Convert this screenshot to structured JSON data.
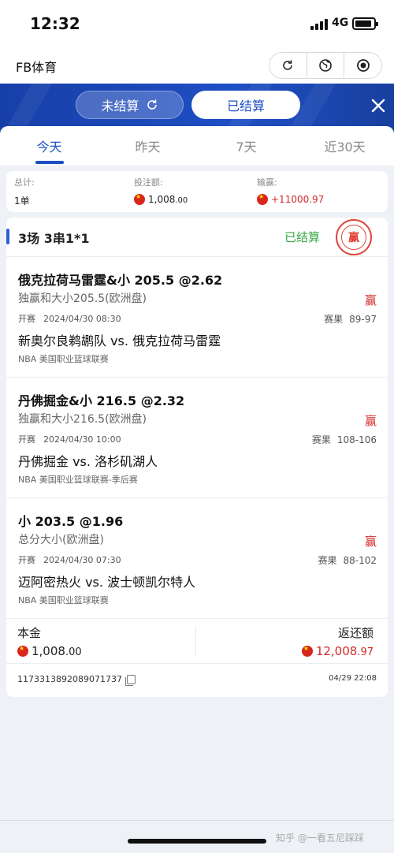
{
  "status": {
    "time": "12:32",
    "network": "4G",
    "battery_level": 0.8
  },
  "app": {
    "title": "FB体育"
  },
  "header": {
    "pending_label": "未结算",
    "settled_label": "已结算"
  },
  "tabs": [
    "今天",
    "昨天",
    "7天",
    "近30天"
  ],
  "summary": {
    "total_label": "总计:",
    "total_value": "1单",
    "stake_label": "投注额:",
    "stake_int": "1,008",
    "stake_dec": ".00",
    "win_label": "输赢:",
    "win_value": "+11000.97"
  },
  "card": {
    "title": "3场 3串1*1",
    "status": "已结算",
    "stamp": "赢",
    "bets": [
      {
        "pick": "俄克拉荷马雷霆&小 205.5 @2.62",
        "market": "独赢和大小205.5(欧洲盘)",
        "outcome": "赢",
        "start_label": "开赛",
        "start_time": "2024/04/30 08:30",
        "result_label": "赛果",
        "score": "89-97",
        "teams": "新奥尔良鹈鹕队 vs. 俄克拉荷马雷霆",
        "league": "NBA 美国职业篮球联赛"
      },
      {
        "pick": "丹佛掘金&小 216.5 @2.32",
        "market": "独赢和大小216.5(欧洲盘)",
        "outcome": "赢",
        "start_label": "开赛",
        "start_time": "2024/04/30 10:00",
        "result_label": "赛果",
        "score": "108-106",
        "teams": "丹佛掘金 vs. 洛杉矶湖人",
        "league": "NBA 美国职业篮球联赛-季后赛"
      },
      {
        "pick": "小 203.5 @1.96",
        "market": "总分大小(欧洲盘)",
        "outcome": "赢",
        "start_label": "开赛",
        "start_time": "2024/04/30 07:30",
        "result_label": "赛果",
        "score": "88-102",
        "teams": "迈阿密热火 vs. 波士顿凯尔特人",
        "league": "NBA 美国职业篮球联赛"
      }
    ],
    "principal_label": "本金",
    "principal_int": "1,008",
    "principal_dec": ".00",
    "return_label": "返还额",
    "return_int": "12,008",
    "return_dec": ".97",
    "order_id": "1173313892089071737",
    "timestamp": "04/29 22:08"
  },
  "watermark": "知乎 @一看五尼踩踩"
}
